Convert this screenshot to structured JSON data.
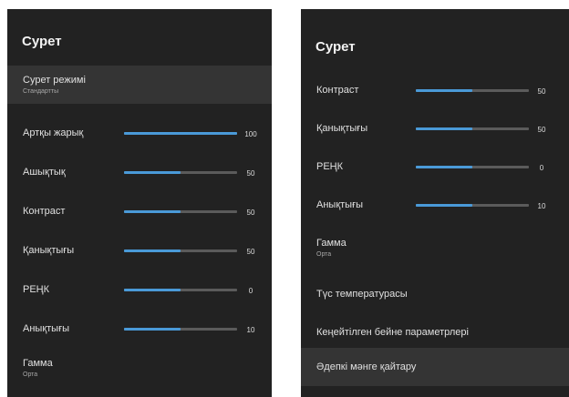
{
  "left": {
    "title": "Сурет",
    "items": [
      {
        "label": "Сурет режимі",
        "sub": "Стандартты",
        "selected": true
      },
      {
        "label": "Артқы жарық",
        "value": "100",
        "level": 1.0
      },
      {
        "label": "Ашықтық",
        "value": "50",
        "level": 0.5
      },
      {
        "label": "Контраст",
        "value": "50",
        "level": 0.5
      },
      {
        "label": "Қанықтығы",
        "value": "50",
        "level": 0.5
      },
      {
        "label": "РЕҢК",
        "value": "0",
        "level": 0.5
      },
      {
        "label": "Анықтығы",
        "value": "10",
        "level": 0.5
      },
      {
        "label": "Гамма",
        "sub": "Орта"
      }
    ]
  },
  "right": {
    "title": "Сурет",
    "items": [
      {
        "label": "Контраст",
        "value": "50",
        "level": 0.5
      },
      {
        "label": "Қанықтығы",
        "value": "50",
        "level": 0.5
      },
      {
        "label": "РЕҢК",
        "value": "0",
        "level": 0.5
      },
      {
        "label": "Анықтығы",
        "value": "10",
        "level": 0.5
      },
      {
        "label": "Гамма",
        "sub": "Орта"
      },
      {
        "label": "Түс температурасы"
      },
      {
        "label": "Кеңейтілген бейне параметрлері"
      },
      {
        "label": "Әдепкі мәнге қайтару",
        "selected": true
      }
    ]
  },
  "colors": {
    "accent": "#4a9ad8",
    "panel_bg": "#222222",
    "selected_bg": "#343434",
    "track": "#5b5b5b"
  }
}
